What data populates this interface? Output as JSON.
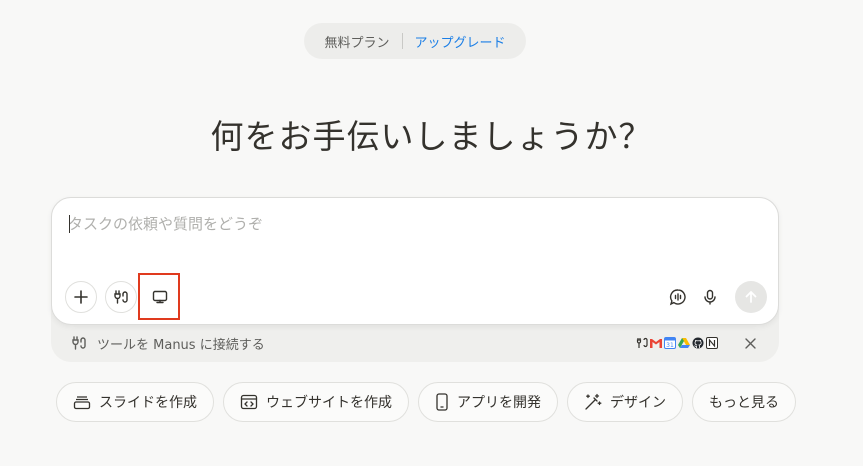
{
  "plan": {
    "current": "無料プラン",
    "upgrade": "アップグレード"
  },
  "heading": "何をお手伝いしましょうか？",
  "composer": {
    "placeholder": "タスクの依頼や質問をどうぞ",
    "value": ""
  },
  "connect": {
    "label": "ツールを Manus に接続する",
    "apps": [
      "tools-icon",
      "gmail-icon",
      "calendar-icon",
      "drive-icon",
      "github-icon",
      "notion-icon"
    ]
  },
  "chips": [
    {
      "label": "スライドを作成",
      "icon": "slides-icon"
    },
    {
      "label": "ウェブサイトを作成",
      "icon": "code-window-icon"
    },
    {
      "label": "アプリを開発",
      "icon": "phone-icon"
    },
    {
      "label": "デザイン",
      "icon": "magic-wand-icon"
    },
    {
      "label": "もっと見る",
      "icon": ""
    }
  ],
  "colors": {
    "accent": "#1a7ee6",
    "highlight": "#e03a1e",
    "background": "#f8f8f7"
  }
}
